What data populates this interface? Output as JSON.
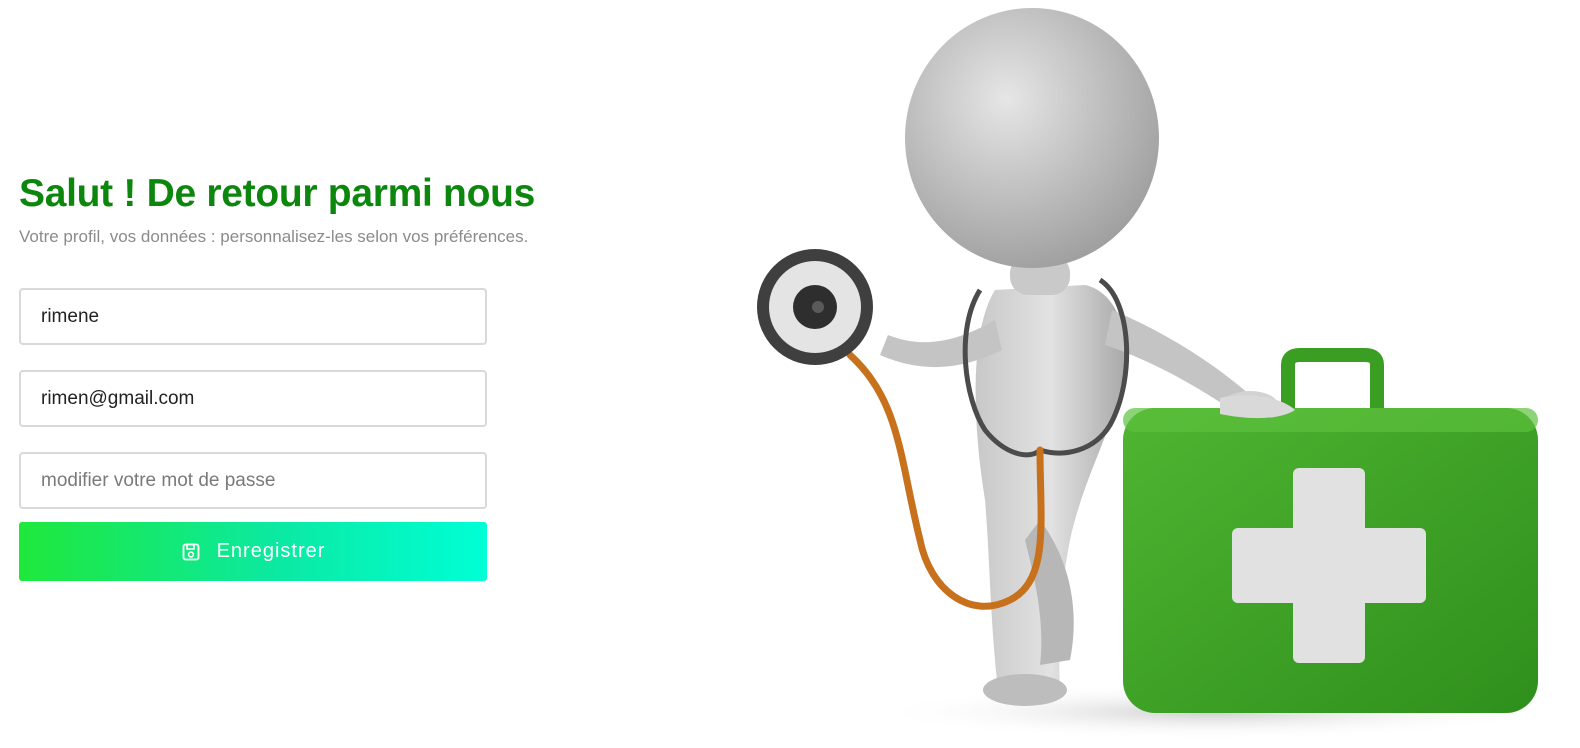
{
  "header": {
    "title": "Salut ! De retour parmi nous",
    "subtitle": "Votre profil, vos données : personnalisez-les selon vos préférences."
  },
  "form": {
    "username": {
      "value": "rimene"
    },
    "email": {
      "value": "rimen@gmail.com"
    },
    "password": {
      "value": "",
      "placeholder": "modifier votre mot de passe"
    },
    "submit": {
      "label": "Enregistrer",
      "icon": "save-icon"
    }
  },
  "illustration": {
    "subject": "3d-figure-with-stethoscope-and-first-aid-kit"
  },
  "colors": {
    "title": "#0d860d",
    "subtitle": "#8b8b8b",
    "button_gradient_start": "#1fe83c",
    "button_gradient_end": "#00ffd6",
    "kit_green": "#3fa92a"
  }
}
